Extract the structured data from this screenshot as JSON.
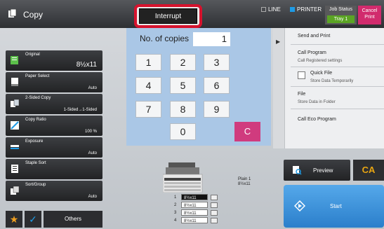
{
  "header": {
    "title": "Copy",
    "interrupt_label": "Interrupt",
    "line_label": "LINE",
    "printer_label": "PRINTER",
    "job_status_label": "Job Status",
    "tray_label": "Tray 1",
    "cancel_print_line1": "Cancel",
    "cancel_print_line2": "Print"
  },
  "settings": [
    {
      "label": "Original",
      "value": "8½x11",
      "icon": "original-icon"
    },
    {
      "label": "Paper Select",
      "value": "Auto",
      "icon": "paper-select-icon"
    },
    {
      "label": "2-Sided Copy",
      "value": "1-Sided→1-Sided",
      "icon": "two-sided-icon"
    },
    {
      "label": "Copy Ratio",
      "value": "100 %",
      "icon": "copy-ratio-icon"
    },
    {
      "label": "Exposure",
      "value": "Auto",
      "icon": "exposure-icon"
    },
    {
      "label": "Staple Sort",
      "value": "",
      "icon": "staple-sort-icon"
    },
    {
      "label": "Sort/Group",
      "value": "Auto",
      "icon": "sort-group-icon"
    }
  ],
  "bottom_left": {
    "others_label": "Others"
  },
  "keypad": {
    "copies_label": "No. of copies",
    "copies_value": "1",
    "keys": [
      "1",
      "2",
      "3",
      "4",
      "5",
      "6",
      "7",
      "8",
      "9",
      "0"
    ],
    "clear_label": "C"
  },
  "right_panel": {
    "items": [
      {
        "title": "Send and Print",
        "sub": ""
      },
      {
        "title": "Call Program",
        "sub": "Call Registered settings"
      },
      {
        "title": "Quick File",
        "sub": "Store Data Temporarily"
      },
      {
        "title": "File",
        "sub": "Store Data in Folder"
      },
      {
        "title": "Call Eco Program",
        "sub": ""
      }
    ]
  },
  "paper": {
    "label_line1": "Plain 1",
    "label_line2": "8½x11",
    "trays": [
      {
        "num": "1",
        "size": "8½x11"
      },
      {
        "num": "2",
        "size": "8½x11"
      },
      {
        "num": "3",
        "size": "8½x11"
      },
      {
        "num": "4",
        "size": "8½x11"
      }
    ]
  },
  "actions": {
    "preview_label": "Preview",
    "ca_label": "CA",
    "start_label": "Start"
  },
  "colors": {
    "interrupt_ring": "#d6122d",
    "start": "#3a8fdc",
    "cancel": "#d12b6d",
    "tray_green": "#5ba424",
    "ca": "#e8a512"
  }
}
